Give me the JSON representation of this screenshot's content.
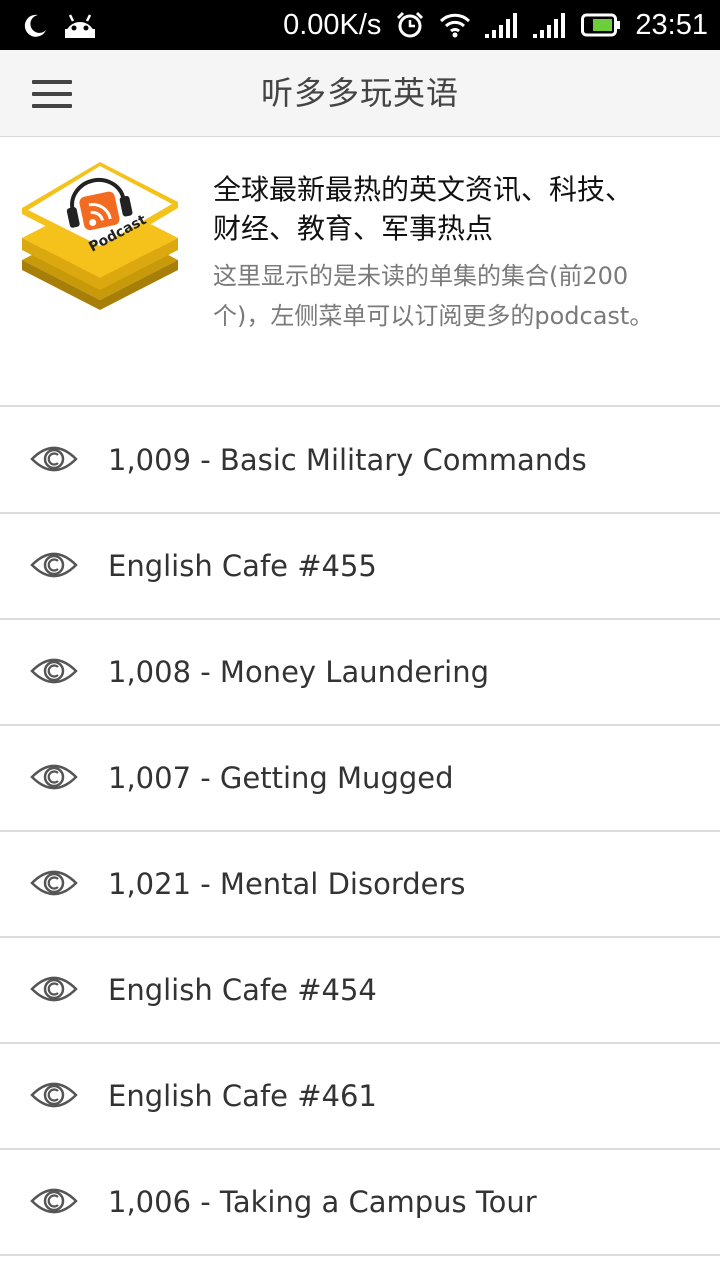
{
  "status_bar": {
    "speed": "0.00K/s",
    "time": "23:51",
    "icons": [
      "moon-icon",
      "android-icon",
      "alarm-icon",
      "wifi-icon",
      "signal-icon",
      "signal-icon",
      "battery-icon"
    ]
  },
  "app_bar": {
    "title": "听多多玩英语",
    "menu_icon": "hamburger-menu-icon"
  },
  "header": {
    "logo_text": "Podcast",
    "headline": "全球最新最热的英文资讯、科技、财经、教育、军事热点",
    "description": "这里显示的是未读的单集的集合(前200个)，左侧菜单可以订阅更多的podcast。"
  },
  "episodes": [
    {
      "title": "1,009 - Basic Military Commands",
      "icon": "eye-icon"
    },
    {
      "title": "English Cafe #455",
      "icon": "eye-icon"
    },
    {
      "title": "1,008 - Money Laundering",
      "icon": "eye-icon"
    },
    {
      "title": "1,007 - Getting Mugged",
      "icon": "eye-icon"
    },
    {
      "title": "1,021 - Mental Disorders",
      "icon": "eye-icon"
    },
    {
      "title": "English Cafe #454",
      "icon": "eye-icon"
    },
    {
      "title": "English Cafe #461",
      "icon": "eye-icon"
    },
    {
      "title": "1,006 - Taking a Campus Tour",
      "icon": "eye-icon"
    }
  ],
  "colors": {
    "status_bar": "#000000",
    "app_bar": "#f5f5f5",
    "logo_yellow": "#f5c21b",
    "rss_orange": "#f26b21"
  }
}
